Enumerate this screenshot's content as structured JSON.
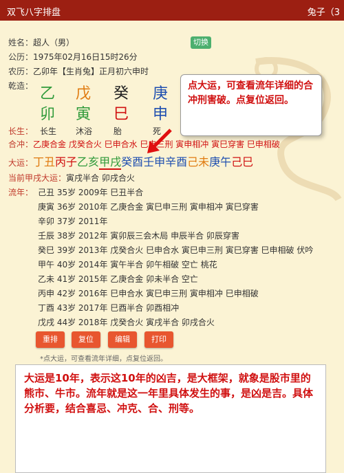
{
  "header": {
    "title": "双飞八字排盘",
    "user": "兔子（3"
  },
  "name": {
    "label": "姓名：",
    "value": "超人（男）",
    "switch_label": "切换"
  },
  "solar": {
    "label": "公历：",
    "value": "1975年02月16日15时26分"
  },
  "lunar": {
    "label": "农历：",
    "value": "乙卯年【生肖兔】正月初六申时"
  },
  "qianzao": {
    "label": "乾造：",
    "stems": [
      "乙",
      "戊",
      "癸",
      "庚"
    ],
    "branches": [
      "卯",
      "寅",
      "巳",
      "申"
    ]
  },
  "changsheng": {
    "label": "长生：",
    "values": [
      "长生",
      "沐浴",
      "胎",
      "死"
    ]
  },
  "hechong": {
    "label": "合冲：",
    "value": "乙庚合金 戊癸合火 巳申合水 巳申三刑 寅申相冲 寅巳穿害 巳申相破"
  },
  "dayun": {
    "label": "大运：",
    "items": [
      "丁丑",
      "丙子",
      "乙亥",
      "甲戌",
      "癸酉",
      "壬申",
      "辛酉",
      "己未",
      "庚午",
      "己巳"
    ]
  },
  "current_dayun": {
    "label": "当前甲戌大运：",
    "value": "寅戌半合 卯戌合火"
  },
  "liunian": {
    "label": "流年：",
    "rows": [
      "己丑 35岁 2009年 巳丑半合",
      "庚寅 36岁 2010年 乙庚合金  寅巳申三刑  寅申相冲  寅巳穿害",
      "辛卯 37岁 2011年",
      "壬辰 38岁 2012年 寅卯辰三会木局  申辰半合  卯辰穿害",
      "癸巳 39岁 2013年 戊癸合火  巳申合水  寅巳申三刑  寅巳穿害  巳申相破  伏吟",
      "甲午 40岁 2014年 寅午半合  卯午相破  空亡  桃花",
      "乙未 41岁 2015年 乙庚合金  卯未半合  空亡",
      "丙申 42岁 2016年 巳申合水  寅巳申三刑  寅申相冲  巳申相破",
      "丁酉 43岁 2017年 巳酉半合  卯酉相冲",
      "戊戌 44岁 2018年 戊癸合火  寅戌半合  卯戌合火"
    ]
  },
  "buttons": {
    "rearrange": "重排",
    "reset": "复位",
    "edit": "编辑",
    "print": "打印"
  },
  "footnote": "*点大运，可查看流年详细，点复位返回。",
  "tooltip": "点大运，可查看流年详细的合冲刑害破。点复位返回。",
  "note": "大运是10年，表示这10年的凶吉，是大框架，就象是股市里的熊市、牛市。流年就是这一年里具体发生的事，是凶是吉。具体分析要，结合喜忌、冲克、合、刑等。"
}
